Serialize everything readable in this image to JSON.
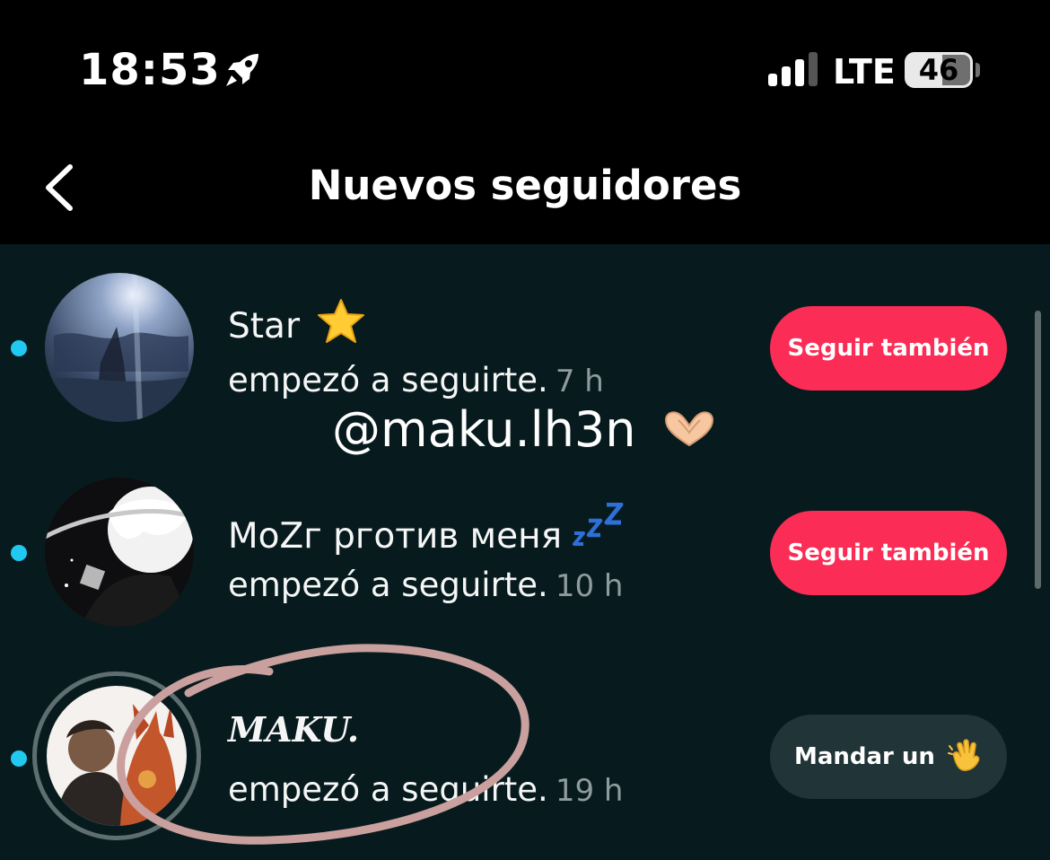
{
  "status_bar": {
    "time": "18:53",
    "network": "LTE",
    "battery": "46"
  },
  "header": {
    "title": "Nuevos seguidores"
  },
  "followers": [
    {
      "name": "Star",
      "name_emoji": "star-emoji",
      "action": "empezó a seguirte.",
      "time_ago": "7 h",
      "button_label": "Seguir también",
      "unread": true
    },
    {
      "name": "MoZг pготив меня",
      "name_emoji": "zzz-emoji",
      "action": "empezó a seguirte.",
      "time_ago": "10 h",
      "button_label": "Seguir también",
      "unread": true
    },
    {
      "name": "MAKU.",
      "action": "empezó a seguirte.",
      "time_ago": "19 h",
      "button_label": "Mandar un",
      "button_emoji": "waving-hand-emoji",
      "unread": true,
      "has_story": true
    }
  ],
  "overlay": {
    "handle": "@maku.lh3n"
  },
  "colors": {
    "background": "#071b1e",
    "header_background": "#000000",
    "follow_button": "#fb2c55",
    "wave_button": "#213437",
    "unread_dot": "#21c8f0",
    "time_ago_text": "#8f9b9d",
    "annotation_stroke": "#c9a09e"
  }
}
